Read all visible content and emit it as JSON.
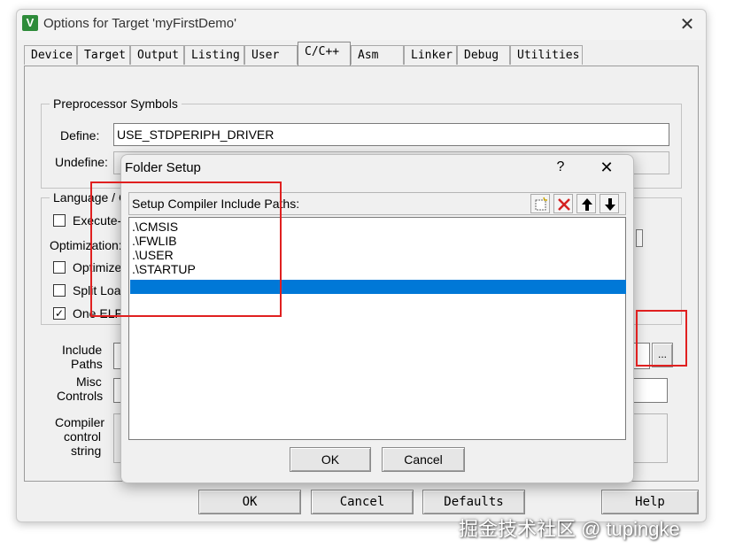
{
  "window": {
    "title": "Options for Target 'myFirstDemo'",
    "close_glyph": "✕"
  },
  "tabs": [
    {
      "label": "Device"
    },
    {
      "label": "Target"
    },
    {
      "label": "Output"
    },
    {
      "label": "Listing"
    },
    {
      "label": "User"
    },
    {
      "label": "C/C++"
    },
    {
      "label": "Asm"
    },
    {
      "label": "Linker"
    },
    {
      "label": "Debug"
    },
    {
      "label": "Utilities"
    }
  ],
  "active_tab": "C/C++",
  "preprocessor": {
    "group_label": "Preprocessor Symbols",
    "define_label": "Define:",
    "define_value": "USE_STDPERIPH_DRIVER",
    "undefine_label": "Undefine:",
    "undefine_value": ""
  },
  "language": {
    "group_label": "Language / C",
    "execute_label": "Execute-o",
    "optimization_label": "Optimization:",
    "optimize_label": "Optimize f",
    "split_label": "Split Load",
    "one_elf_label": "One ELF",
    "one_elf_checked": "✓"
  },
  "lower": {
    "include_label_1": "Include",
    "include_label_2": "Paths",
    "misc_label_1": "Misc",
    "misc_label_2": "Controls",
    "compiler_label_1": "Compiler",
    "compiler_label_2": "control",
    "compiler_label_3": "string",
    "browse_label": "..."
  },
  "bottom_buttons": {
    "ok": "OK",
    "cancel": "Cancel",
    "defaults": "Defaults",
    "help": "Help"
  },
  "folder_dialog": {
    "title": "Folder Setup",
    "help_glyph": "?",
    "close_glyph": "✕",
    "list_label": "Setup Compiler Include Paths:",
    "paths": [
      ".\\CMSIS",
      ".\\FWLIB",
      ".\\USER",
      ".\\STARTUP"
    ],
    "toolbar_icons": [
      "new-folder-icon",
      "delete-icon",
      "move-up-icon",
      "move-down-icon"
    ],
    "ok": "OK",
    "cancel": "Cancel"
  },
  "watermark": "掘金技术社区 @ tupingke",
  "colors": {
    "selection": "#0078d7",
    "highlight_box": "#e02020",
    "app_icon": "#2e8b3a"
  }
}
